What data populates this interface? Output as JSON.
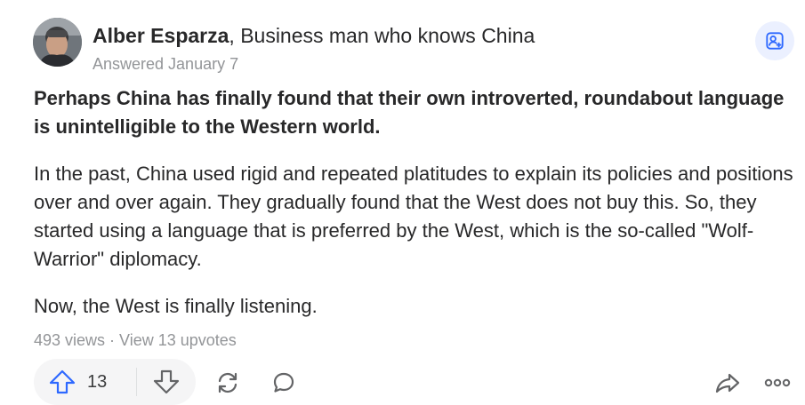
{
  "author": {
    "name": "Alber Esparza",
    "separator": ", ",
    "credential": "Business man who knows China",
    "answered": "Answered January 7"
  },
  "answer": {
    "lead": "Perhaps China has finally found that their own introverted, roundabout language is unintelligible to the Western world.",
    "paragraphs": [
      "In the past, China used rigid and repeated platitudes to explain its policies and positions over and over again. They gradually found that the West does not buy this. So, they started using a language that is preferred by the West, which is the so-called \"Wolf-Warrior\" diplomacy.",
      "Now, the West is finally listening."
    ]
  },
  "stats": {
    "views": "493 views",
    "dot": " · ",
    "upvotes_link": "View 13 upvotes"
  },
  "actions": {
    "upvote_count": "13",
    "icons": {
      "upvote": "arrow-up-icon",
      "downvote": "arrow-down-icon",
      "share_loop": "refresh-icon",
      "comment": "comment-icon",
      "share": "share-arrow-icon",
      "more": "more-dots-icon",
      "follow": "follow-user-icon"
    }
  },
  "colors": {
    "accent_blue": "#2e69ff",
    "icon_gray": "#636466",
    "meta_gray": "#939598",
    "text": "#282829",
    "pill_bg": "#f5f5f6",
    "follow_bg": "#ebf0ff"
  }
}
